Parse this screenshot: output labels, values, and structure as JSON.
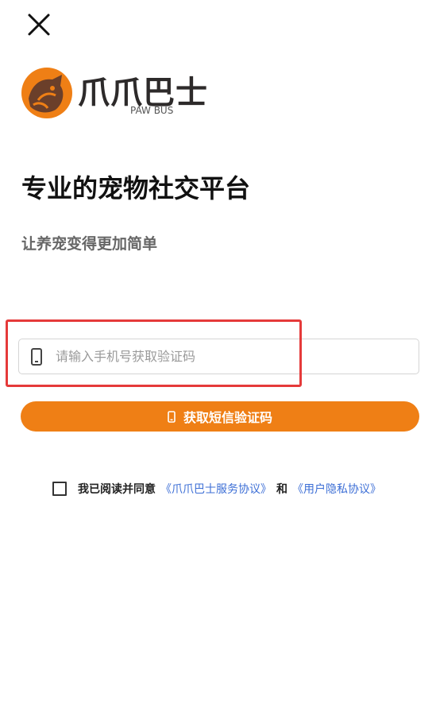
{
  "logo": {
    "name": "爪爪巴士",
    "subname": "PAW BUS",
    "brand_orange": "#ef7f15",
    "brand_dark": "#6b3f2a"
  },
  "hero": {
    "title": "专业的宠物社交平台",
    "subtitle": "让养宠变得更加简单"
  },
  "form": {
    "phone_placeholder": "请输入手机号获取验证码",
    "get_code_label": "获取短信验证码"
  },
  "agreement": {
    "prefix": "我已阅读并同意",
    "service_link": "《爪爪巴士服务协议》",
    "conjunction": "和",
    "privacy_link": "《用户隐私协议》",
    "checked": false
  },
  "colors": {
    "accent": "#ef7f15",
    "link": "#3d6fd6",
    "highlight": "#e53a3a"
  },
  "icons": [
    "close-icon",
    "logo-mark-icon",
    "phone-icon",
    "checkbox-icon"
  ]
}
